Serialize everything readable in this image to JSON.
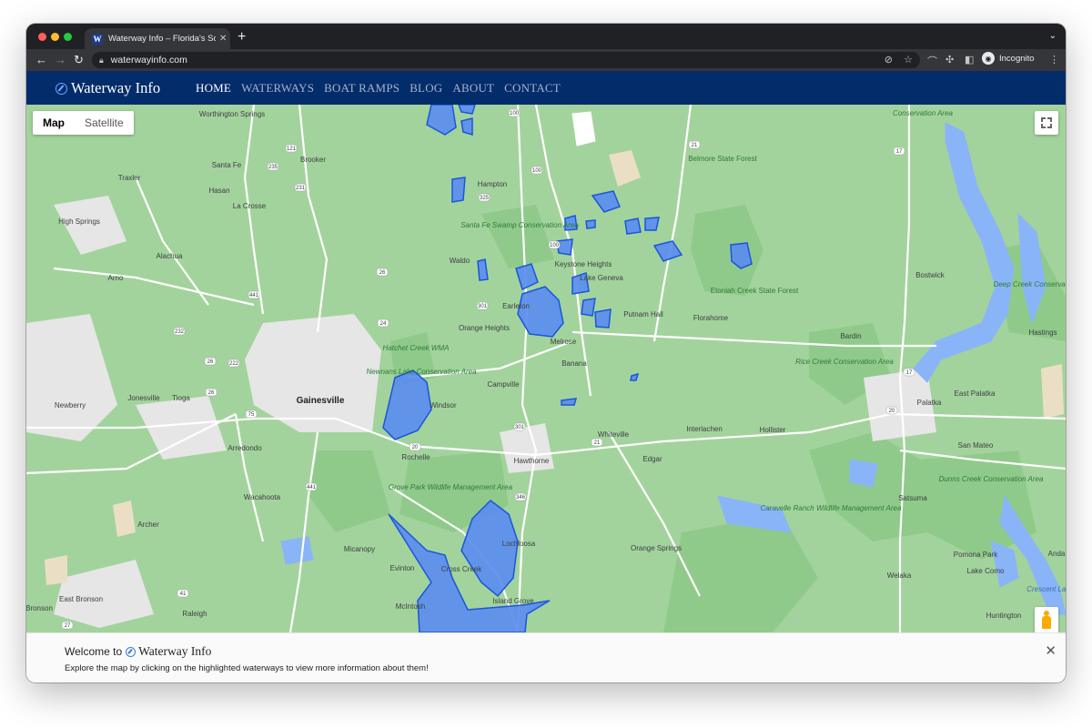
{
  "browser": {
    "tab_title": "Waterway Info – Florida's Sour",
    "tab_favicon": "W",
    "tab_close": "✕",
    "new_tab": "+",
    "url": "waterwayinfo.com",
    "incognito_label": "Incognito"
  },
  "site": {
    "brand": "Waterway Info",
    "nav": [
      {
        "label": "HOME",
        "active": true
      },
      {
        "label": "WATERWAYS"
      },
      {
        "label": "BOAT RAMPS"
      },
      {
        "label": "BLOG"
      },
      {
        "label": "ABOUT"
      },
      {
        "label": "CONTACT"
      }
    ]
  },
  "map": {
    "type_buttons": [
      "Map",
      "Satellite"
    ],
    "selected_type": "Map",
    "colors": {
      "land": "#a3d39c",
      "forest": "#8fca8a",
      "urban": "#e6e6e6",
      "water_natural": "#8ab4f8",
      "waterway_highlight": "#5b8def",
      "waterway_stroke": "#1a56db",
      "road": "#ffffff"
    },
    "places": [
      "Worthington Springs",
      "Brooker",
      "Santa Fe",
      "Traxler",
      "Hasan",
      "La Crosse",
      "High Springs",
      "Alachua",
      "Arno",
      "Hampton",
      "Santa Fe Swamp Conservation Area",
      "Waldo",
      "Keystone Heights",
      "Lake Geneva",
      "Earleton",
      "Orange Heights",
      "Putnam Hall",
      "Melrose",
      "Florahome",
      "Belmore State Forest",
      "Etoniah Creek State Forest",
      "Bostwick",
      "Deep Creek Conservation Area",
      "Bardin",
      "Hastings",
      "Hatchet Creek WMA",
      "Newnans Lake Conservation Area",
      "Gainesville",
      "Newberry",
      "Jonesville",
      "Tioga",
      "Windsor",
      "Campville",
      "Banana",
      "Rice Creek Conservation Area",
      "Palatka",
      "East Palatka",
      "Arredondo",
      "Rochelle",
      "Hawthorne",
      "Whiteville",
      "Interlachen",
      "Hollister",
      "Edgar",
      "San Mateo",
      "Wacahoota",
      "Grove Park Wildlife Management Area",
      "Archer",
      "Micanopy",
      "Lochloosa",
      "Cross Creek",
      "Evinton",
      "McIntosh",
      "Island Grove",
      "Orange Springs",
      "Caravelle Ranch Wildlife Management Area",
      "Satsuma",
      "Dunns Creek Conservation Area",
      "Pomona Park",
      "Welaka",
      "Lake Como",
      "Raleigh",
      "East Bronson",
      "Bronson",
      "Huntington",
      "Conservation Area",
      "Anda",
      "Crescent Lake"
    ],
    "route_shields": [
      "100",
      "121",
      "21",
      "17",
      "100",
      "235",
      "231",
      "325",
      "26",
      "441",
      "301",
      "232",
      "222",
      "24",
      "26",
      "75",
      "20",
      "21",
      "301",
      "441",
      "346",
      "41",
      "27",
      "20",
      "17",
      "26",
      "100"
    ]
  },
  "welcome": {
    "prefix": "Welcome to",
    "brand": "Waterway Info",
    "text": "Explore the map by clicking on the highlighted waterways to view more information about them!",
    "close": "✕"
  }
}
